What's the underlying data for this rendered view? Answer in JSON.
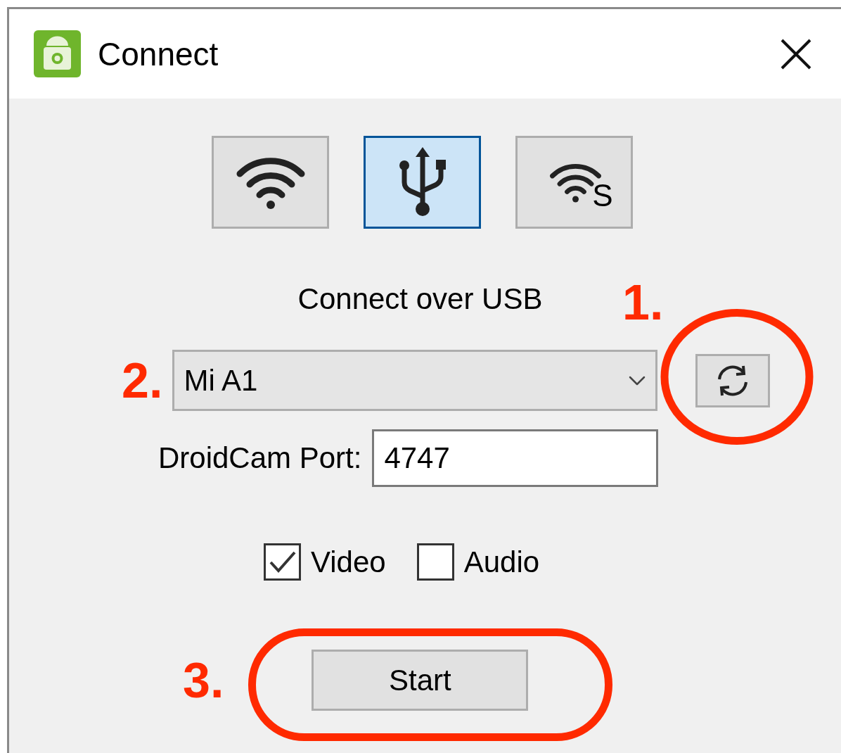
{
  "window": {
    "title": "Connect"
  },
  "modes": [
    {
      "kind": "wifi",
      "selected": false
    },
    {
      "kind": "usb",
      "selected": true
    },
    {
      "kind": "wifi_server",
      "badge": "S",
      "selected": false
    }
  ],
  "heading": "Connect over USB",
  "device": {
    "value": "Mi A1"
  },
  "port": {
    "label": "DroidCam Port:",
    "value": "4747"
  },
  "checkboxes": [
    {
      "label": "Video",
      "checked": true
    },
    {
      "label": "Audio",
      "checked": false
    }
  ],
  "start_button": "Start",
  "annotations": [
    "1.",
    "2.",
    "3."
  ]
}
